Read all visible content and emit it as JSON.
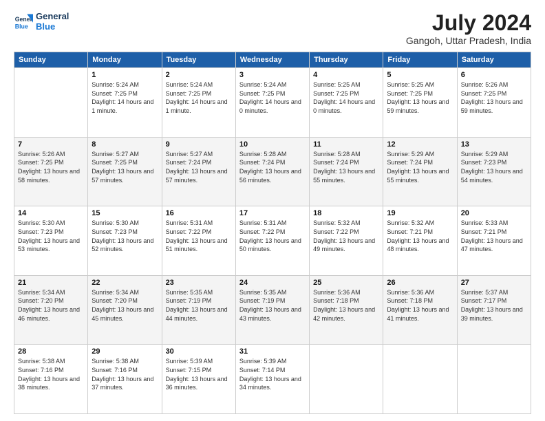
{
  "logo": {
    "line1": "General",
    "line2": "Blue"
  },
  "title": "July 2024",
  "location": "Gangoh, Uttar Pradesh, India",
  "weekdays": [
    "Sunday",
    "Monday",
    "Tuesday",
    "Wednesday",
    "Thursday",
    "Friday",
    "Saturday"
  ],
  "weeks": [
    [
      {
        "day": "",
        "sunrise": "",
        "sunset": "",
        "daylight": ""
      },
      {
        "day": "1",
        "sunrise": "Sunrise: 5:24 AM",
        "sunset": "Sunset: 7:25 PM",
        "daylight": "Daylight: 14 hours and 1 minute."
      },
      {
        "day": "2",
        "sunrise": "Sunrise: 5:24 AM",
        "sunset": "Sunset: 7:25 PM",
        "daylight": "Daylight: 14 hours and 1 minute."
      },
      {
        "day": "3",
        "sunrise": "Sunrise: 5:24 AM",
        "sunset": "Sunset: 7:25 PM",
        "daylight": "Daylight: 14 hours and 0 minutes."
      },
      {
        "day": "4",
        "sunrise": "Sunrise: 5:25 AM",
        "sunset": "Sunset: 7:25 PM",
        "daylight": "Daylight: 14 hours and 0 minutes."
      },
      {
        "day": "5",
        "sunrise": "Sunrise: 5:25 AM",
        "sunset": "Sunset: 7:25 PM",
        "daylight": "Daylight: 13 hours and 59 minutes."
      },
      {
        "day": "6",
        "sunrise": "Sunrise: 5:26 AM",
        "sunset": "Sunset: 7:25 PM",
        "daylight": "Daylight: 13 hours and 59 minutes."
      }
    ],
    [
      {
        "day": "7",
        "sunrise": "Sunrise: 5:26 AM",
        "sunset": "Sunset: 7:25 PM",
        "daylight": "Daylight: 13 hours and 58 minutes."
      },
      {
        "day": "8",
        "sunrise": "Sunrise: 5:27 AM",
        "sunset": "Sunset: 7:25 PM",
        "daylight": "Daylight: 13 hours and 57 minutes."
      },
      {
        "day": "9",
        "sunrise": "Sunrise: 5:27 AM",
        "sunset": "Sunset: 7:24 PM",
        "daylight": "Daylight: 13 hours and 57 minutes."
      },
      {
        "day": "10",
        "sunrise": "Sunrise: 5:28 AM",
        "sunset": "Sunset: 7:24 PM",
        "daylight": "Daylight: 13 hours and 56 minutes."
      },
      {
        "day": "11",
        "sunrise": "Sunrise: 5:28 AM",
        "sunset": "Sunset: 7:24 PM",
        "daylight": "Daylight: 13 hours and 55 minutes."
      },
      {
        "day": "12",
        "sunrise": "Sunrise: 5:29 AM",
        "sunset": "Sunset: 7:24 PM",
        "daylight": "Daylight: 13 hours and 55 minutes."
      },
      {
        "day": "13",
        "sunrise": "Sunrise: 5:29 AM",
        "sunset": "Sunset: 7:23 PM",
        "daylight": "Daylight: 13 hours and 54 minutes."
      }
    ],
    [
      {
        "day": "14",
        "sunrise": "Sunrise: 5:30 AM",
        "sunset": "Sunset: 7:23 PM",
        "daylight": "Daylight: 13 hours and 53 minutes."
      },
      {
        "day": "15",
        "sunrise": "Sunrise: 5:30 AM",
        "sunset": "Sunset: 7:23 PM",
        "daylight": "Daylight: 13 hours and 52 minutes."
      },
      {
        "day": "16",
        "sunrise": "Sunrise: 5:31 AM",
        "sunset": "Sunset: 7:22 PM",
        "daylight": "Daylight: 13 hours and 51 minutes."
      },
      {
        "day": "17",
        "sunrise": "Sunrise: 5:31 AM",
        "sunset": "Sunset: 7:22 PM",
        "daylight": "Daylight: 13 hours and 50 minutes."
      },
      {
        "day": "18",
        "sunrise": "Sunrise: 5:32 AM",
        "sunset": "Sunset: 7:22 PM",
        "daylight": "Daylight: 13 hours and 49 minutes."
      },
      {
        "day": "19",
        "sunrise": "Sunrise: 5:32 AM",
        "sunset": "Sunset: 7:21 PM",
        "daylight": "Daylight: 13 hours and 48 minutes."
      },
      {
        "day": "20",
        "sunrise": "Sunrise: 5:33 AM",
        "sunset": "Sunset: 7:21 PM",
        "daylight": "Daylight: 13 hours and 47 minutes."
      }
    ],
    [
      {
        "day": "21",
        "sunrise": "Sunrise: 5:34 AM",
        "sunset": "Sunset: 7:20 PM",
        "daylight": "Daylight: 13 hours and 46 minutes."
      },
      {
        "day": "22",
        "sunrise": "Sunrise: 5:34 AM",
        "sunset": "Sunset: 7:20 PM",
        "daylight": "Daylight: 13 hours and 45 minutes."
      },
      {
        "day": "23",
        "sunrise": "Sunrise: 5:35 AM",
        "sunset": "Sunset: 7:19 PM",
        "daylight": "Daylight: 13 hours and 44 minutes."
      },
      {
        "day": "24",
        "sunrise": "Sunrise: 5:35 AM",
        "sunset": "Sunset: 7:19 PM",
        "daylight": "Daylight: 13 hours and 43 minutes."
      },
      {
        "day": "25",
        "sunrise": "Sunrise: 5:36 AM",
        "sunset": "Sunset: 7:18 PM",
        "daylight": "Daylight: 13 hours and 42 minutes."
      },
      {
        "day": "26",
        "sunrise": "Sunrise: 5:36 AM",
        "sunset": "Sunset: 7:18 PM",
        "daylight": "Daylight: 13 hours and 41 minutes."
      },
      {
        "day": "27",
        "sunrise": "Sunrise: 5:37 AM",
        "sunset": "Sunset: 7:17 PM",
        "daylight": "Daylight: 13 hours and 39 minutes."
      }
    ],
    [
      {
        "day": "28",
        "sunrise": "Sunrise: 5:38 AM",
        "sunset": "Sunset: 7:16 PM",
        "daylight": "Daylight: 13 hours and 38 minutes."
      },
      {
        "day": "29",
        "sunrise": "Sunrise: 5:38 AM",
        "sunset": "Sunset: 7:16 PM",
        "daylight": "Daylight: 13 hours and 37 minutes."
      },
      {
        "day": "30",
        "sunrise": "Sunrise: 5:39 AM",
        "sunset": "Sunset: 7:15 PM",
        "daylight": "Daylight: 13 hours and 36 minutes."
      },
      {
        "day": "31",
        "sunrise": "Sunrise: 5:39 AM",
        "sunset": "Sunset: 7:14 PM",
        "daylight": "Daylight: 13 hours and 34 minutes."
      },
      {
        "day": "",
        "sunrise": "",
        "sunset": "",
        "daylight": ""
      },
      {
        "day": "",
        "sunrise": "",
        "sunset": "",
        "daylight": ""
      },
      {
        "day": "",
        "sunrise": "",
        "sunset": "",
        "daylight": ""
      }
    ]
  ]
}
